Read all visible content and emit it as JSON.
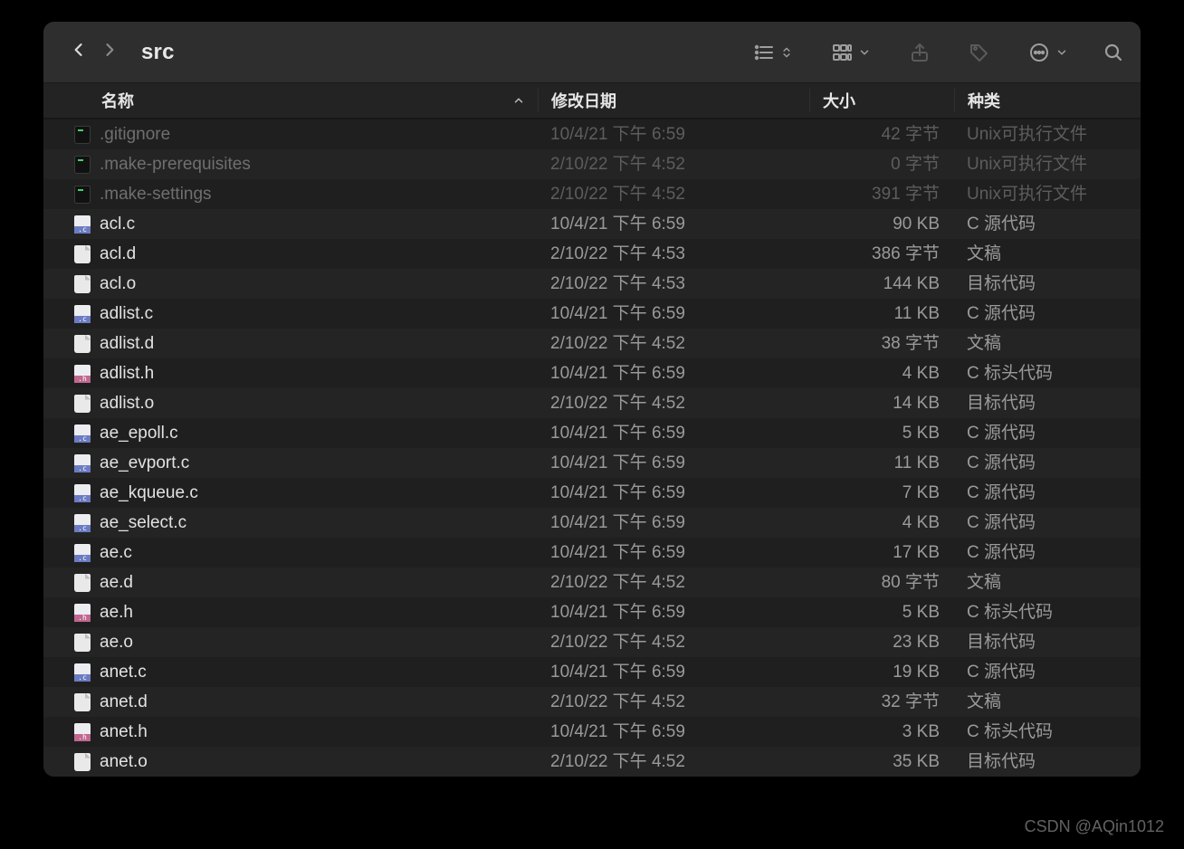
{
  "window": {
    "title": "src"
  },
  "columns": {
    "name": "名称",
    "date": "修改日期",
    "size": "大小",
    "kind": "种类"
  },
  "files": [
    {
      "name": ".gitignore",
      "date": "10/4/21 下午 6:59",
      "size": "42 字节",
      "kind": "Unix可执行文件",
      "icon": "exec",
      "dim": true
    },
    {
      "name": ".make-prerequisites",
      "date": "2/10/22 下午 4:52",
      "size": "0 字节",
      "kind": "Unix可执行文件",
      "icon": "exec",
      "dim": true
    },
    {
      "name": ".make-settings",
      "date": "2/10/22 下午 4:52",
      "size": "391 字节",
      "kind": "Unix可执行文件",
      "icon": "exec",
      "dim": true
    },
    {
      "name": "acl.c",
      "date": "10/4/21 下午 6:59",
      "size": "90 KB",
      "kind": "C 源代码",
      "icon": "c"
    },
    {
      "name": "acl.d",
      "date": "2/10/22 下午 4:53",
      "size": "386 字节",
      "kind": "文稿",
      "icon": "doc"
    },
    {
      "name": "acl.o",
      "date": "2/10/22 下午 4:53",
      "size": "144 KB",
      "kind": "目标代码",
      "icon": "doc"
    },
    {
      "name": "adlist.c",
      "date": "10/4/21 下午 6:59",
      "size": "11 KB",
      "kind": "C 源代码",
      "icon": "c"
    },
    {
      "name": "adlist.d",
      "date": "2/10/22 下午 4:52",
      "size": "38 字节",
      "kind": "文稿",
      "icon": "doc"
    },
    {
      "name": "adlist.h",
      "date": "10/4/21 下午 6:59",
      "size": "4 KB",
      "kind": "C 标头代码",
      "icon": "h"
    },
    {
      "name": "adlist.o",
      "date": "2/10/22 下午 4:52",
      "size": "14 KB",
      "kind": "目标代码",
      "icon": "doc"
    },
    {
      "name": "ae_epoll.c",
      "date": "10/4/21 下午 6:59",
      "size": "5 KB",
      "kind": "C 源代码",
      "icon": "c"
    },
    {
      "name": "ae_evport.c",
      "date": "10/4/21 下午 6:59",
      "size": "11 KB",
      "kind": "C 源代码",
      "icon": "c"
    },
    {
      "name": "ae_kqueue.c",
      "date": "10/4/21 下午 6:59",
      "size": "7 KB",
      "kind": "C 源代码",
      "icon": "c"
    },
    {
      "name": "ae_select.c",
      "date": "10/4/21 下午 6:59",
      "size": "4 KB",
      "kind": "C 源代码",
      "icon": "c"
    },
    {
      "name": "ae.c",
      "date": "10/4/21 下午 6:59",
      "size": "17 KB",
      "kind": "C 源代码",
      "icon": "c"
    },
    {
      "name": "ae.d",
      "date": "2/10/22 下午 4:52",
      "size": "80 字节",
      "kind": "文稿",
      "icon": "doc"
    },
    {
      "name": "ae.h",
      "date": "10/4/21 下午 6:59",
      "size": "5 KB",
      "kind": "C 标头代码",
      "icon": "h"
    },
    {
      "name": "ae.o",
      "date": "2/10/22 下午 4:52",
      "size": "23 KB",
      "kind": "目标代码",
      "icon": "doc"
    },
    {
      "name": "anet.c",
      "date": "10/4/21 下午 6:59",
      "size": "19 KB",
      "kind": "C 源代码",
      "icon": "c"
    },
    {
      "name": "anet.d",
      "date": "2/10/22 下午 4:52",
      "size": "32 字节",
      "kind": "文稿",
      "icon": "doc"
    },
    {
      "name": "anet.h",
      "date": "10/4/21 下午 6:59",
      "size": "3 KB",
      "kind": "C 标头代码",
      "icon": "h"
    },
    {
      "name": "anet.o",
      "date": "2/10/22 下午 4:52",
      "size": "35 KB",
      "kind": "目标代码",
      "icon": "doc"
    }
  ],
  "watermark": "CSDN @AQin1012"
}
